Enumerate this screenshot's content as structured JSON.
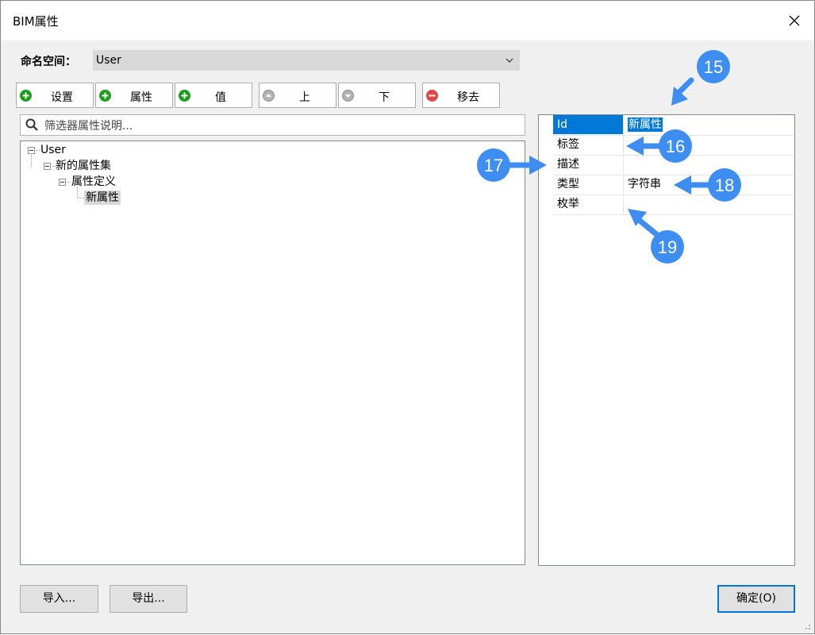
{
  "window": {
    "title": "BIM属性"
  },
  "namespace": {
    "label": "命名空间：",
    "value": "User"
  },
  "toolbar": [
    {
      "label": "设置",
      "icon": "add-icon"
    },
    {
      "label": "属性",
      "icon": "add-icon"
    },
    {
      "label": "值",
      "icon": "add-icon"
    },
    {
      "label": "上",
      "icon": "up-icon"
    },
    {
      "label": "下",
      "icon": "down-icon"
    },
    {
      "label": "移去",
      "icon": "remove-icon"
    }
  ],
  "search": {
    "placeholder": "筛选器属性说明..."
  },
  "tree": {
    "root": "User",
    "set": "新的属性集",
    "definition": "属性定义",
    "property": "新属性"
  },
  "properties": [
    {
      "key": "Id",
      "value": "新属性"
    },
    {
      "key": "标签",
      "value": ""
    },
    {
      "key": "描述",
      "value": ""
    },
    {
      "key": "类型",
      "value": "字符串"
    },
    {
      "key": "枚举",
      "value": ""
    }
  ],
  "callouts": [
    "15",
    "16",
    "17",
    "18",
    "19"
  ],
  "buttons": {
    "import": "导入...",
    "export": "导出...",
    "ok": "确定(O)"
  },
  "colors": {
    "callout": "#3d8ef0",
    "selection": "#0078d7",
    "add": "#1a9e1a",
    "remove": "#e04848",
    "move": "#a0a0a0"
  }
}
